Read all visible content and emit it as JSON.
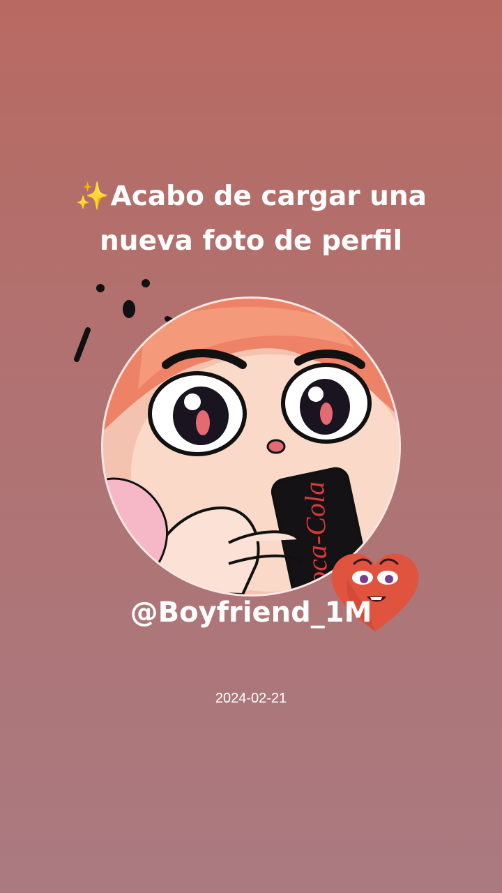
{
  "post": {
    "headline_emoji": "✨",
    "headline_text": "Acabo de cargar una nueva foto de perfil",
    "username": "@Boyfriend_1M",
    "date": "2024-02-21"
  },
  "avatar": {
    "icon": "cartoon-character-with-cola-can",
    "can_text": "Coca-Cola"
  },
  "sticker": {
    "icon": "heart-face-sticker"
  },
  "colors": {
    "background_top": "#b86a62",
    "background_bottom": "#aa7a80",
    "text": "#ffffff",
    "heart": "#e0533f"
  }
}
